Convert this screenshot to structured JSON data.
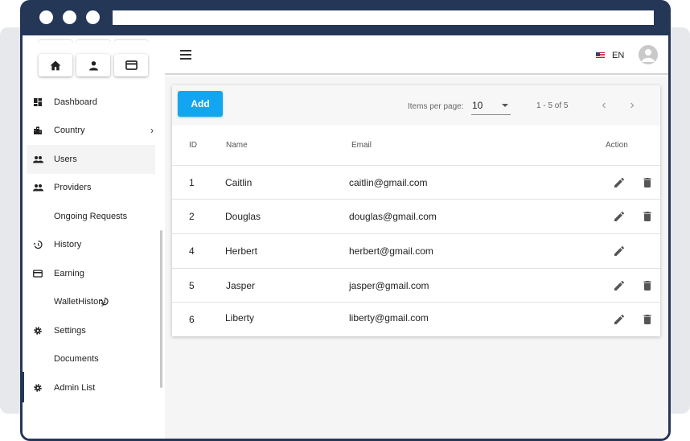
{
  "sidebar": {
    "top_icons": [
      {
        "icon": "home-icon"
      },
      {
        "icon": "person-icon"
      },
      {
        "icon": "credit-card-icon"
      }
    ],
    "items": [
      {
        "label": "Dashboard",
        "icon": "dashboard-icon"
      },
      {
        "label": "Country",
        "icon": "city-icon",
        "chevron": "›"
      },
      {
        "label": "Users",
        "icon": "people-icon"
      },
      {
        "label": "Providers",
        "icon": "people-icon"
      },
      {
        "label": "Ongoing Requests",
        "icon": ""
      },
      {
        "label": "History",
        "icon": "history-icon"
      },
      {
        "label": "Earning",
        "icon": "credit-card-icon"
      },
      {
        "label": "WalletHistory",
        "icon": ""
      },
      {
        "label": "Settings",
        "icon": "gear-icon"
      },
      {
        "label": "Documents",
        "icon": ""
      },
      {
        "label": "Admin List",
        "icon": "gear-icon"
      }
    ],
    "active_item": "Users"
  },
  "toolbar": {
    "menu_icon": "menu-icon",
    "language": "EN",
    "flag_icon": "us-flag-icon",
    "avatar_icon": "account-circle-icon"
  },
  "table_controls": {
    "add_label": "Add",
    "items_per_page_label": "Items per page:",
    "items_per_page_value": "10",
    "range_label": "1 - 5 of 5",
    "prev_icon": "‹",
    "next_icon": "›"
  },
  "table": {
    "headers": {
      "id": "ID",
      "name": "Name",
      "email": "Email",
      "action": "Action"
    },
    "rows": [
      {
        "id": "1",
        "name": "Caitlin",
        "email": "caitlin@gmail.com",
        "delete": true
      },
      {
        "id": "2",
        "name": "Douglas",
        "email": "douglas@gmail.com",
        "delete": true
      },
      {
        "id": "4",
        "name": "Herbert",
        "email": "herbert@gmail.com",
        "delete": false
      },
      {
        "id": "5",
        "name": "Jasper",
        "email": "jasper@gmail.com",
        "delete": true
      },
      {
        "id": "6",
        "name": "Liberty",
        "email": "liberty@gmail.com",
        "delete": true
      }
    ]
  },
  "colors": {
    "frame": "#253757",
    "accent": "#12a6f2",
    "icon": "#555555"
  }
}
